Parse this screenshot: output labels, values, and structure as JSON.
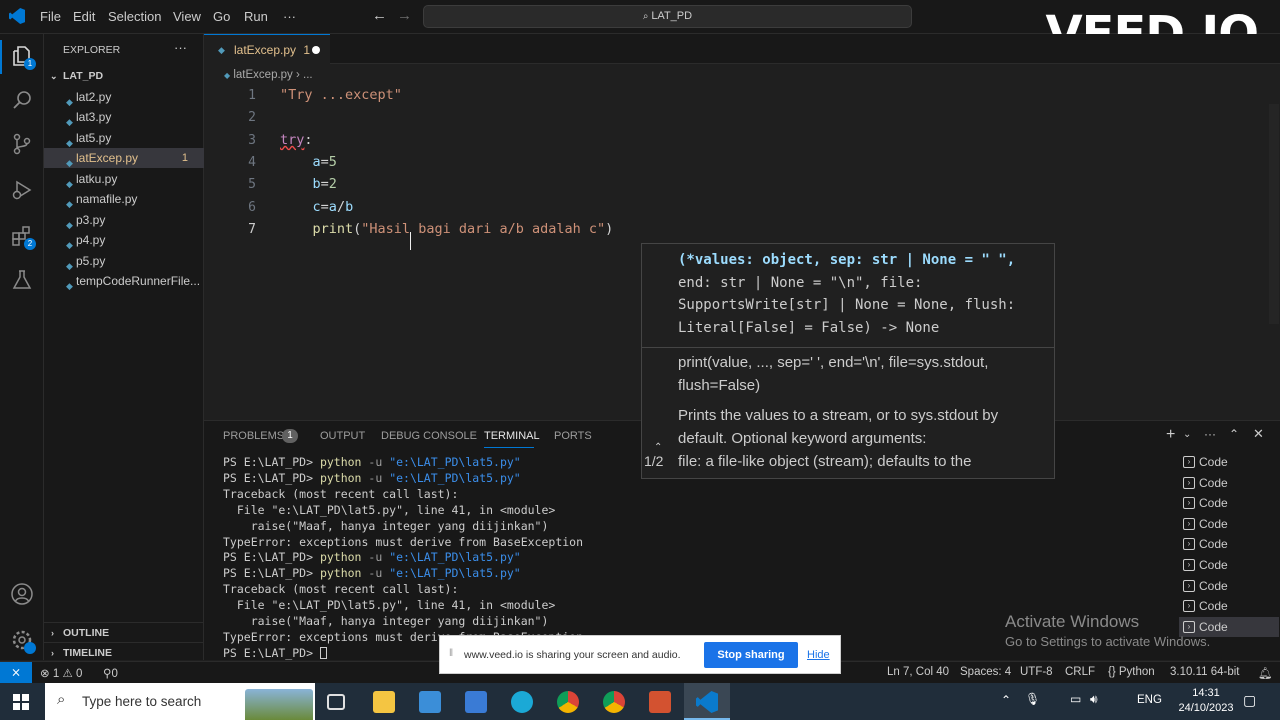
{
  "titlebar": {
    "menus": [
      "File",
      "Edit",
      "Selection",
      "View",
      "Go",
      "Run",
      "···"
    ],
    "search": "LAT_PD",
    "watermark": "VEED.IO"
  },
  "explorer": {
    "title": "EXPLORER",
    "folder": "LAT_PD",
    "files": [
      "lat2.py",
      "lat3.py",
      "lat5.py",
      "latExcep.py",
      "latku.py",
      "namafile.py",
      "p3.py",
      "p4.py",
      "p5.py",
      "tempCodeRunnerFile..."
    ],
    "active_file": "latExcep.py",
    "active_badge": "1",
    "outline": "OUTLINE",
    "timeline": "TIMELINE"
  },
  "activity_badges": {
    "explorer": "1",
    "extensions": "2"
  },
  "editor": {
    "tab_label": "latExcep.py",
    "tab_badge": "1",
    "breadcrumb": "latExcep.py",
    "breadcrumb_more": "...",
    "lines": [
      {
        "n": "1",
        "parts": [
          [
            "\"Try ...except\"",
            "str"
          ]
        ]
      },
      {
        "n": "2",
        "parts": []
      },
      {
        "n": "3",
        "parts": [
          [
            "try",
            "kw"
          ],
          [
            ":",
            "op"
          ]
        ]
      },
      {
        "n": "4",
        "parts": [
          [
            "    ",
            "op"
          ],
          [
            "a",
            "var"
          ],
          [
            "=",
            "op"
          ],
          [
            "5",
            "num"
          ]
        ]
      },
      {
        "n": "5",
        "parts": [
          [
            "    ",
            "op"
          ],
          [
            "b",
            "var"
          ],
          [
            "=",
            "op"
          ],
          [
            "2",
            "num"
          ]
        ]
      },
      {
        "n": "6",
        "parts": [
          [
            "    ",
            "op"
          ],
          [
            "c",
            "var"
          ],
          [
            "=",
            "op"
          ],
          [
            "a",
            "var"
          ],
          [
            "/",
            "op"
          ],
          [
            "b",
            "var"
          ]
        ]
      },
      {
        "n": "7",
        "parts": [
          [
            "    ",
            "op"
          ],
          [
            "print",
            "fn"
          ],
          [
            "(",
            "op"
          ],
          [
            "\"Hasil bagi dari a/b adalah c\"",
            "str"
          ],
          [
            ")",
            "op"
          ]
        ]
      }
    ]
  },
  "hover": {
    "signature_lines": [
      "(*values: object, sep: str | None = \" \",",
      "end: str | None = \"\\n\", file:",
      "SupportsWrite[str] | None = None, flush:",
      "Literal[False] = False) -> None"
    ],
    "doc_lines": [
      "print(value, ..., sep=' ', end='\\n', file=sys.stdout,",
      "flush=False)",
      "",
      "Prints the values to a stream, or to sys.stdout by",
      "default. Optional keyword arguments:",
      "file: a file-like object (stream); defaults to the"
    ],
    "pager": "1/2"
  },
  "panel": {
    "tabs": [
      "PROBLEMS",
      "OUTPUT",
      "DEBUG CONSOLE",
      "TERMINAL",
      "PORTS"
    ],
    "problems_count": "1",
    "active_tab": "TERMINAL",
    "terminal_lines": [
      "PS E:\\LAT_PD> python -u \"e:\\LAT_PD\\lat5.py\"",
      "PS E:\\LAT_PD> python -u \"e:\\LAT_PD\\lat5.py\"",
      "Traceback (most recent call last):",
      "  File \"e:\\LAT_PD\\lat5.py\", line 41, in <module>",
      "    raise(\"Maaf, hanya integer yang diijinkan\")",
      "TypeError: exceptions must derive from BaseException",
      "PS E:\\LAT_PD> python -u \"e:\\LAT_PD\\lat5.py\"",
      "PS E:\\LAT_PD> python -u \"e:\\LAT_PD\\lat5.py\"",
      "Traceback (most recent call last):",
      "  File \"e:\\LAT_PD\\lat5.py\", line 41, in <module>",
      "    raise(\"Maaf, hanya integer yang diijinkan\")",
      "TypeError: exceptions must derive from BaseException",
      "PS E:\\LAT_PD> "
    ],
    "terminal_list": [
      "Code",
      "Code",
      "Code",
      "Code",
      "Code",
      "Code",
      "Code",
      "Code",
      "Code"
    ]
  },
  "activate_windows": {
    "title": "Activate Windows",
    "subtitle": "Go to Settings to activate Windows."
  },
  "share_bar": {
    "message": "www.veed.io is sharing your screen and audio.",
    "stop": "Stop sharing",
    "hide": "Hide"
  },
  "statusbar": {
    "errors": "1",
    "warnings": "0",
    "ports": "0",
    "position": "Ln 7, Col 40",
    "spaces": "Spaces: 4",
    "encoding": "UTF-8",
    "eol": "CRLF",
    "language": "Python",
    "interpreter": "3.10.11 64-bit"
  },
  "taskbar": {
    "search_placeholder": "Type here to search",
    "language": "ENG",
    "time": "14:31",
    "date": "24/10/2023"
  },
  "colors": {
    "accent": "#0078d4",
    "modified_file": "#e2c08d",
    "string": "#ce9178"
  }
}
